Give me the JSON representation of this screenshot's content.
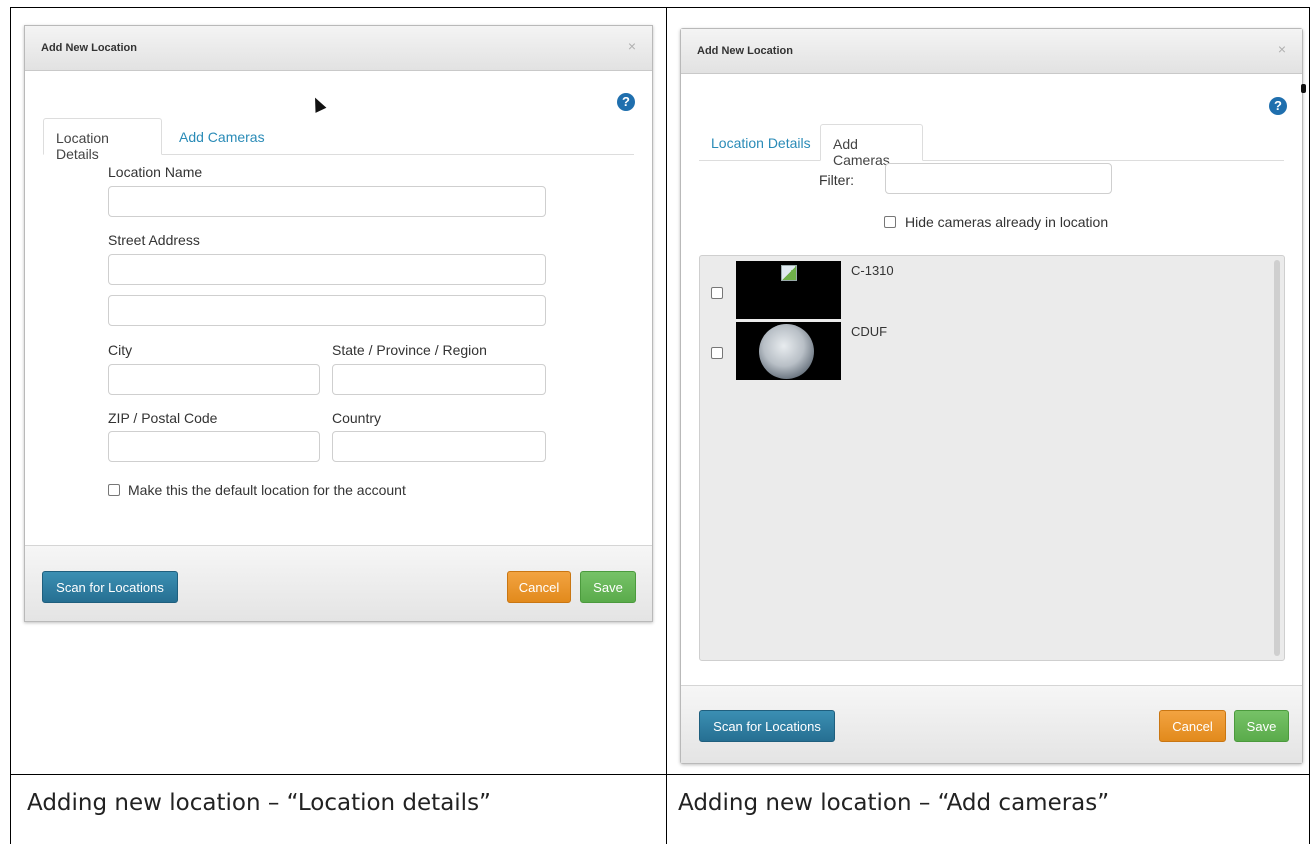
{
  "left_dialog": {
    "title": "Add New Location",
    "close": "×",
    "tabs": [
      "Location Details",
      "Add Cameras"
    ],
    "help": "?",
    "fields": {
      "location_name": "Location Name",
      "street_address": "Street Address",
      "city": "City",
      "state": "State / Province / Region",
      "zip": "ZIP / Postal Code",
      "country": "Country"
    },
    "default_checkbox_label": "Make this the default location for the account",
    "buttons": {
      "scan": "Scan for Locations",
      "cancel": "Cancel",
      "save": "Save"
    }
  },
  "right_dialog": {
    "title": "Add New Location",
    "close": "×",
    "tabs": [
      "Location Details",
      "Add Cameras"
    ],
    "help": "?",
    "filter_label": "Filter:",
    "hide_label": "Hide cameras already in location",
    "cameras": [
      {
        "name": "C-1310"
      },
      {
        "name": "CDUF"
      }
    ],
    "buttons": {
      "scan": "Scan for Locations",
      "cancel": "Cancel",
      "save": "Save"
    }
  },
  "captions": {
    "left": "Adding new location – “Location details”",
    "right": "Adding new location – “Add cameras”"
  },
  "colors": {
    "link": "#2a8bb7",
    "help_icon": "#1f6fae",
    "scan_button": "#2e7fa3",
    "cancel_button": "#e8931f",
    "save_button": "#62b352"
  }
}
